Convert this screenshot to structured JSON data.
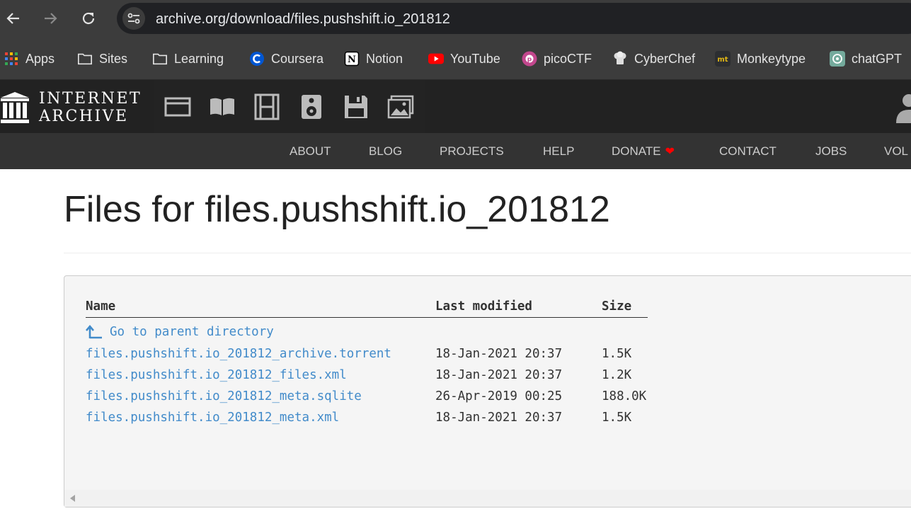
{
  "browser": {
    "url": "archive.org/download/files.pushshift.io_201812",
    "bookmarks": [
      {
        "label": "Apps",
        "icon": "apps-grid-icon"
      },
      {
        "label": "Sites",
        "icon": "folder-icon"
      },
      {
        "label": "Learning",
        "icon": "folder-icon"
      },
      {
        "label": "Coursera",
        "icon": "coursera-icon"
      },
      {
        "label": "Notion",
        "icon": "notion-icon"
      },
      {
        "label": "YouTube",
        "icon": "youtube-icon"
      },
      {
        "label": "picoCTF",
        "icon": "picoctf-icon"
      },
      {
        "label": "CyberChef",
        "icon": "cyberchef-icon"
      },
      {
        "label": "Monkeytype",
        "icon": "monkeytype-icon"
      },
      {
        "label": "chatGPT",
        "icon": "chatgpt-icon"
      }
    ]
  },
  "ia": {
    "logo_line1": "INTERNET",
    "logo_line2": "ARCHIVE",
    "media_icons": [
      "web-icon",
      "texts-icon",
      "video-icon",
      "audio-icon",
      "software-icon",
      "images-icon"
    ],
    "nav": [
      "ABOUT",
      "BLOG",
      "PROJECTS",
      "HELP",
      "DONATE",
      "CONTACT",
      "JOBS",
      "VOL"
    ]
  },
  "colors": {
    "link": "#428bca",
    "donate_heart": "#ff0000",
    "ia_nav_bg": "#333333"
  },
  "page": {
    "title": "Files for files.pushshift.io_201812",
    "columns": [
      "Name",
      "Last modified",
      "Size"
    ],
    "parent_link": "Go to parent directory",
    "files": [
      {
        "name": "files.pushshift.io_201812_archive.torrent",
        "modified": "18-Jan-2021 20:37",
        "size": "1.5K"
      },
      {
        "name": "files.pushshift.io_201812_files.xml",
        "modified": "18-Jan-2021 20:37",
        "size": "1.2K"
      },
      {
        "name": "files.pushshift.io_201812_meta.sqlite",
        "modified": "26-Apr-2019 00:25",
        "size": "188.0K"
      },
      {
        "name": "files.pushshift.io_201812_meta.xml",
        "modified": "18-Jan-2021 20:37",
        "size": "1.5K"
      }
    ]
  }
}
